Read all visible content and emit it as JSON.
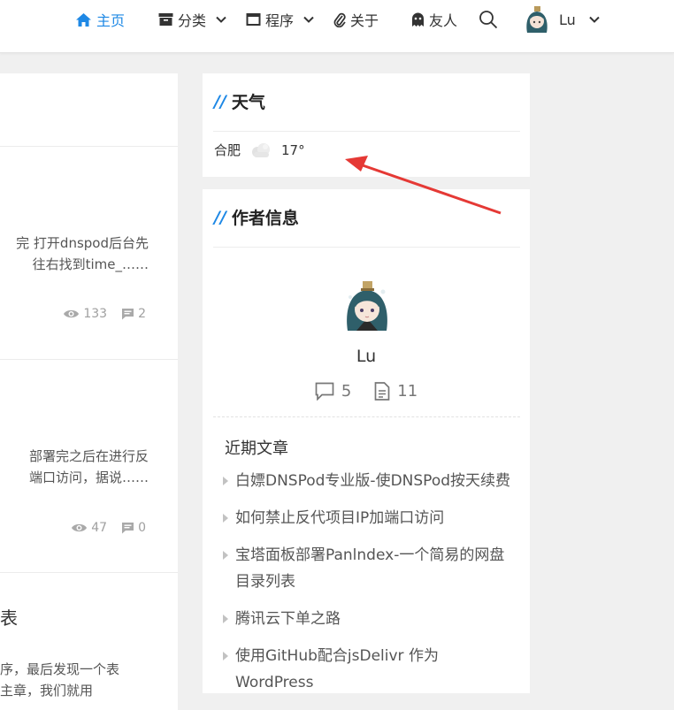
{
  "nav": {
    "home": "主页",
    "category": "分类",
    "program": "程序",
    "about": "关于",
    "friends": "友人",
    "user": "Lu",
    "accent": "#1e88e5"
  },
  "posts": [
    {
      "line1": "完 打开dnspod后台先",
      "line2": "往右找到time_……",
      "views": "133",
      "comments": "2"
    },
    {
      "line1": "部署完之后在进行反",
      "line2": "端口访问，据说……",
      "views": "47",
      "comments": "0"
    },
    {
      "title_fragment": "表",
      "line1": "序，最后发现一个表",
      "line2": "主章，我们就用"
    }
  ],
  "weather": {
    "title": "天气",
    "city": "合肥",
    "temp": "17°",
    "icon": "cloud-icon"
  },
  "author": {
    "title": "作者信息",
    "name": "Lu",
    "comments_count": "5",
    "posts_count": "11"
  },
  "recent": {
    "title": "近期文章",
    "items": [
      "白嫖DNSPod专业版-使DNSPod按天续费",
      "如何禁止反代项目IP加端口访问",
      "宝塔面板部署Panlndex-一个简易的网盘目录列表",
      "腾讯云下单之路",
      "使用GitHub配合jsDelivr 作为WordPress"
    ]
  },
  "annotation": {
    "arrow_color": "#e53935"
  }
}
